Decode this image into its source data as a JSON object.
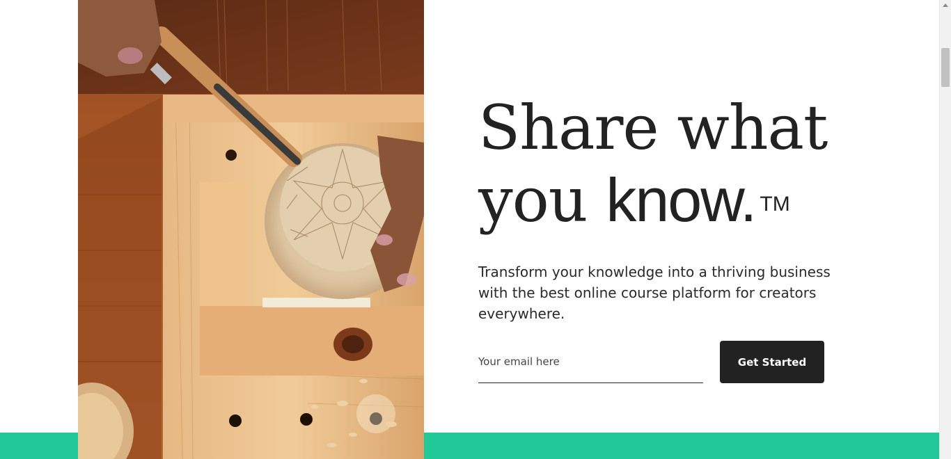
{
  "hero": {
    "headline_line1": "Share what",
    "headline_you": "you ",
    "headline_know": "know.",
    "headline_tm": "TM",
    "subtitle": "Transform your knowledge into a thriving business with the best online course platform for creators everywhere.",
    "image_alt": "Woodcarver chiseling a patterned wooden bowl"
  },
  "signup": {
    "email_placeholder": "Your email here",
    "email_value": "",
    "cta_label": "Get Started"
  },
  "colors": {
    "accent_band": "#20c997",
    "button_bg": "#222222",
    "text": "#222222"
  }
}
